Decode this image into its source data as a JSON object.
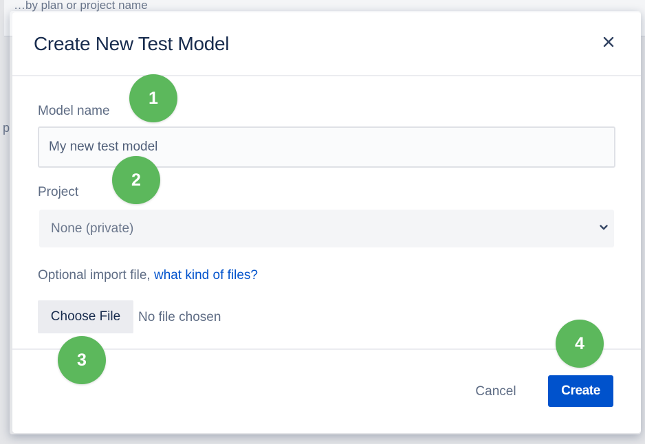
{
  "background": {
    "top_text": "…by plan or project name",
    "left_fragment": "p"
  },
  "dialog": {
    "title": "Create New Test Model",
    "close_label": "×",
    "model_name": {
      "label": "Model name",
      "value": "My new test model"
    },
    "project": {
      "label": "Project",
      "selected": "None (private)"
    },
    "import": {
      "prefix": "Optional import file, ",
      "link_text": "what kind of files?",
      "choose_button": "Choose File",
      "status": "No file chosen"
    },
    "footer": {
      "cancel_label": "Cancel",
      "create_label": "Create"
    }
  },
  "markers": [
    "1",
    "2",
    "3",
    "4"
  ],
  "colors": {
    "primary_button": "#0052cc",
    "link": "#0052cc",
    "marker": "#5cb85c",
    "title": "#172b4d"
  },
  "icons": {
    "close": "close-icon",
    "select_chevron": "chevron-down-icon"
  }
}
